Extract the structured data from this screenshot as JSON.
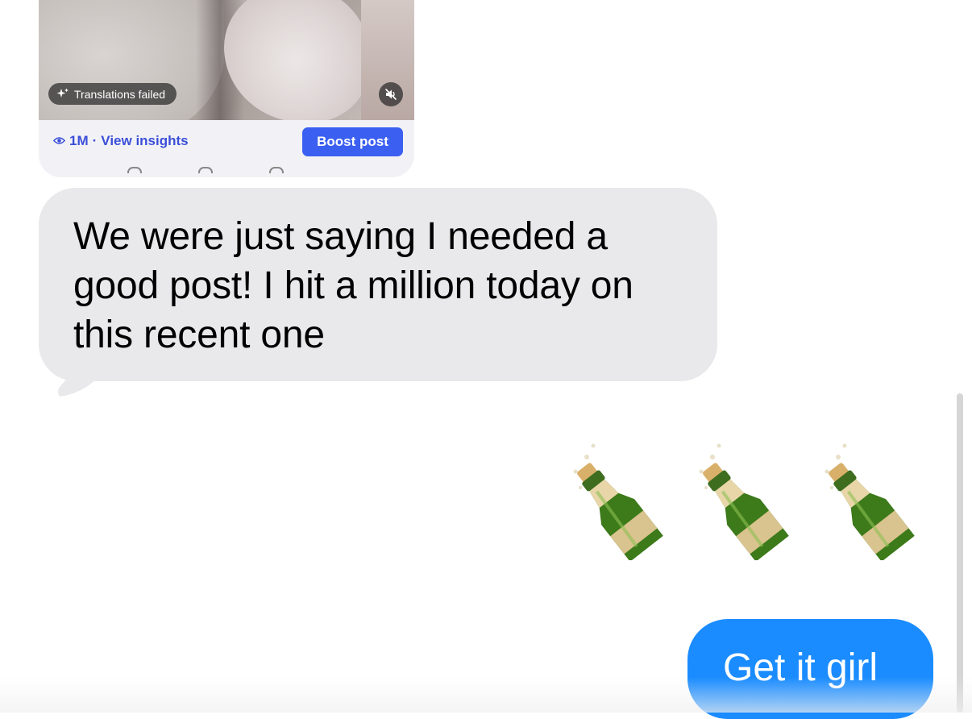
{
  "shared_post": {
    "translation_status": "Translations failed",
    "views": "1M",
    "separator": "·",
    "insights_label": "View insights",
    "boost_label": "Boost post",
    "mute_icon": "speaker-muted-icon",
    "eye_icon": "eye-icon",
    "sparkle_icon": "sparkle-icon"
  },
  "messages": [
    {
      "direction": "received",
      "text": "We were just saying I needed a good post! I hit a million today on this recent one"
    },
    {
      "direction": "sent",
      "emoji": "🍾🍾🍾",
      "emoji_icon": "champagne-bottle-icon"
    },
    {
      "direction": "sent",
      "text": "Get it girl"
    }
  ],
  "colors": {
    "received_bubble": "#e9e9eb",
    "sent_bubble": "#1a8cff",
    "boost_button": "#3b5ff0",
    "insights_link": "#3b4fd8"
  }
}
